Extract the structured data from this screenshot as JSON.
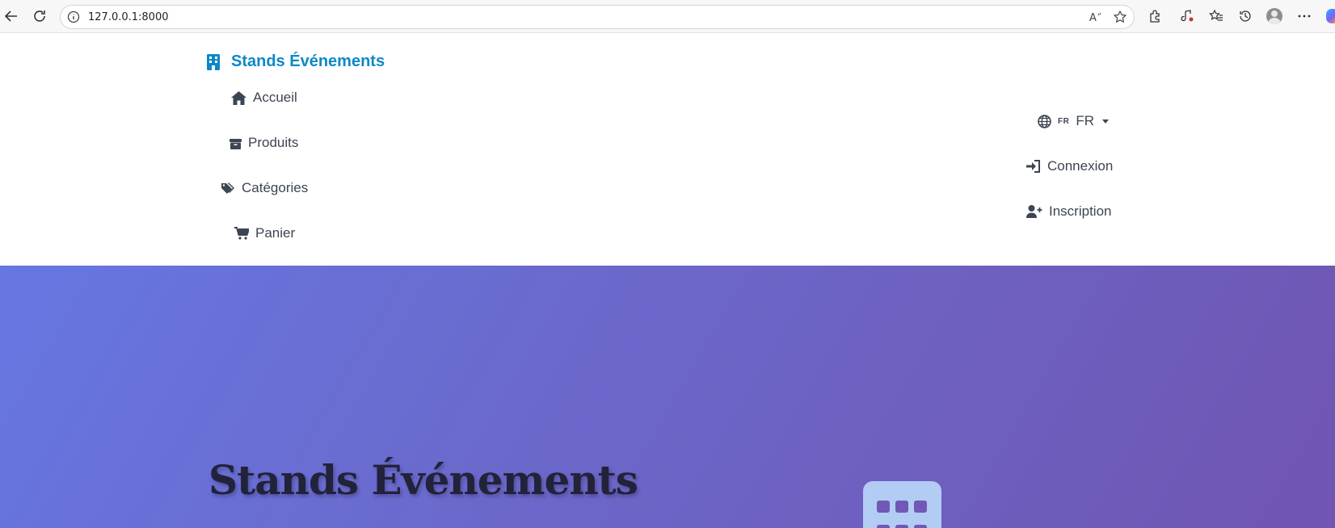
{
  "browser": {
    "url": "127.0.0.1:8000",
    "icons": [
      "back-icon",
      "reload-icon",
      "site-info-icon",
      "read-aloud-icon",
      "favorite-star-icon",
      "extensions-icon",
      "browser-essentials-icon",
      "favorites-icon",
      "history-icon",
      "profile-icon",
      "more-menu-icon",
      "copilot-icon"
    ]
  },
  "navbar": {
    "brand": "Stands Événements",
    "brand_color": "#0d88c7",
    "items": [
      {
        "label": "Accueil",
        "icon": "home-icon"
      },
      {
        "label": "Produits",
        "icon": "box-icon"
      },
      {
        "label": "Catégories",
        "icon": "tags-icon"
      },
      {
        "label": "Panier",
        "icon": "cart-icon"
      }
    ],
    "language": {
      "code_small": "FR",
      "code": "FR",
      "icon": "globe-icon"
    },
    "auth": [
      {
        "label": "Connexion",
        "icon": "sign-in-icon"
      },
      {
        "label": "Inscription",
        "icon": "user-plus-icon"
      }
    ]
  },
  "hero": {
    "title": "Stands Événements",
    "gradient_start": "#6677e2",
    "gradient_end": "#7055b2",
    "icon": "building-icon"
  }
}
